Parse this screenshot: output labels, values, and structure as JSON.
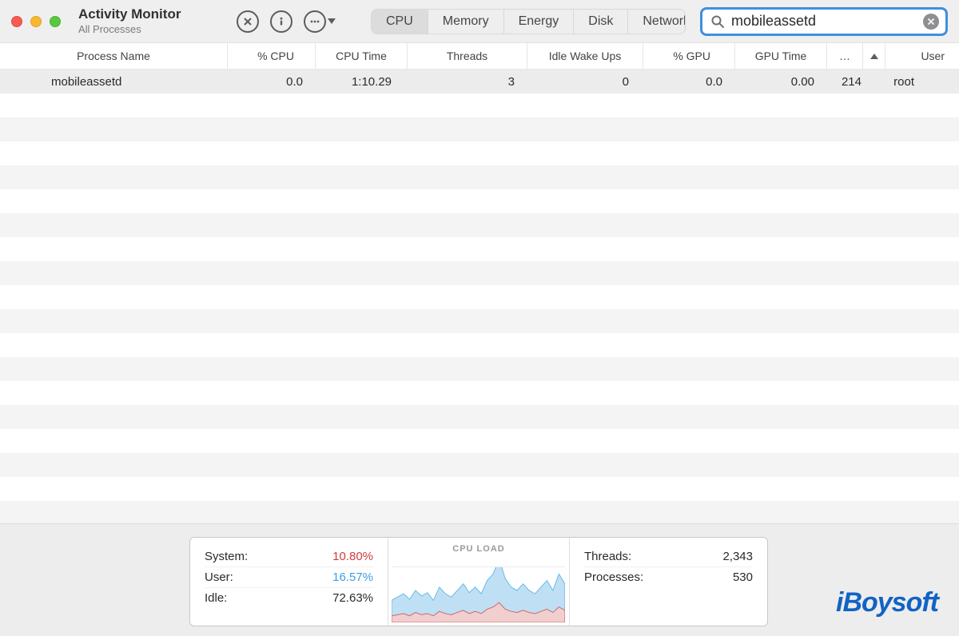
{
  "window": {
    "title": "Activity Monitor",
    "subtitle": "All Processes"
  },
  "tabs": {
    "items": [
      "CPU",
      "Memory",
      "Energy",
      "Disk",
      "Network"
    ],
    "active": "CPU"
  },
  "search": {
    "value": "mobileassetd"
  },
  "columns": {
    "name": "Process Name",
    "cpu": "% CPU",
    "time": "CPU Time",
    "threads": "Threads",
    "wake": "Idle Wake Ups",
    "gpu": "% GPU",
    "gputime": "GPU Time",
    "more": "…",
    "user": "User"
  },
  "rows": [
    {
      "name": "mobileassetd",
      "cpu": "0.0",
      "time": "1:10.29",
      "threads": "3",
      "wake": "0",
      "gpu": "0.0",
      "gputime": "0.00",
      "more": "214",
      "user": "root"
    }
  ],
  "footer": {
    "system_label": "System:",
    "system_value": "10.80%",
    "user_label": "User:",
    "user_value": "16.57%",
    "idle_label": "Idle:",
    "idle_value": "72.63%",
    "threads_label": "Threads:",
    "threads_value": "2,343",
    "processes_label": "Processes:",
    "processes_value": "530",
    "cpu_load_title": "CPU LOAD"
  },
  "watermark": "iBoysoft",
  "chart_data": {
    "type": "area",
    "title": "CPU LOAD",
    "x": [
      0,
      1,
      2,
      3,
      4,
      5,
      6,
      7,
      8,
      9,
      10,
      11,
      12,
      13,
      14,
      15,
      16,
      17,
      18,
      19,
      20,
      21,
      22,
      23,
      24,
      25,
      26,
      27,
      28,
      29
    ],
    "series": [
      {
        "name": "User",
        "color": "#65b9ea",
        "values": [
          14,
          16,
          18,
          15,
          20,
          17,
          19,
          14,
          22,
          18,
          16,
          20,
          24,
          19,
          22,
          18,
          26,
          30,
          40,
          28,
          22,
          20,
          24,
          20,
          18,
          22,
          26,
          20,
          30,
          24
        ]
      },
      {
        "name": "System",
        "color": "#d46a6a",
        "values": [
          6,
          7,
          8,
          6,
          9,
          7,
          8,
          6,
          10,
          8,
          7,
          9,
          11,
          8,
          10,
          8,
          12,
          14,
          18,
          12,
          10,
          9,
          11,
          9,
          8,
          10,
          12,
          9,
          14,
          11
        ]
      }
    ],
    "ylim": [
      0,
      50
    ]
  }
}
